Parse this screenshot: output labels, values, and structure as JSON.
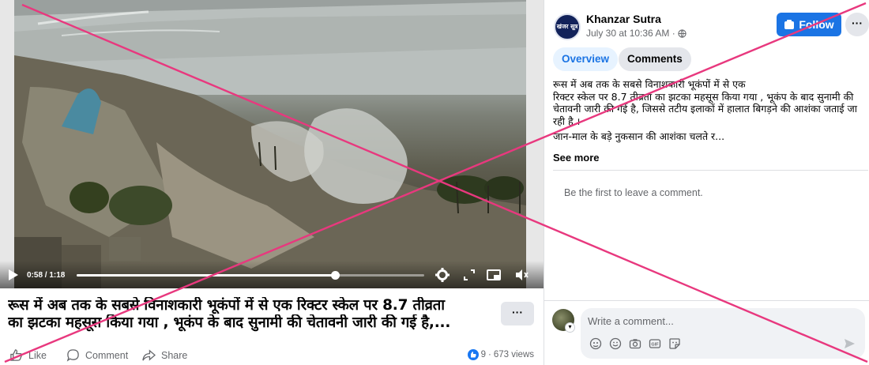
{
  "video": {
    "time_display": "0:58 / 1:18",
    "progress": 0.744
  },
  "post": {
    "title_line1": "रूस में अब तक के सबसे विनाशकारी भूकंपों में से एक रिक्टर स्केल पर 8.7 तीव्रता",
    "title_line2": "का झटका महसूस किया गया , भूकंप के बाद सुनामी की चेतावनी जारी की गई है,...",
    "more_label": "···",
    "actions": {
      "like_label": "Like",
      "comment_label": "Comment",
      "share_label": "Share"
    },
    "reaction_count": "9",
    "views_label": "673 views"
  },
  "page": {
    "avatar_text": "खंजर सूत्र",
    "name": "Khanzar Sutra",
    "date": "July 30 at 10:36 AM ·",
    "follow_label": "Follow",
    "more_label": "···"
  },
  "tabs": [
    {
      "label": "Overview",
      "active": true
    },
    {
      "label": "Comments",
      "active": false
    }
  ],
  "description": {
    "line1": "रूस में अब तक के सबसे विनाशकारी भूकंपों में से एक",
    "line2": "रिक्टर स्केल पर 8.7 तीव्रता का झटका महसूस किया गया , भूकंप के बाद सुनामी की चेतावनी जारी की गई है, जिससे तटीय इलाकों में हालात बिगड़ने की आशंका जताई जा रही है ।",
    "line3": "जान-माल के बड़े नुकसान की आशंका चलते र...",
    "see_more": "See more"
  },
  "comments": {
    "empty_text": "Be the first to leave a comment.",
    "input_placeholder": "Write a comment...",
    "icons": [
      "avatar-icon",
      "emoji-icon",
      "camera-icon",
      "gif-icon",
      "sticker-icon"
    ]
  },
  "colors": {
    "brand_blue": "#1b74e4",
    "cross_pink": "#e8387e",
    "muted_text": "#65676b"
  }
}
